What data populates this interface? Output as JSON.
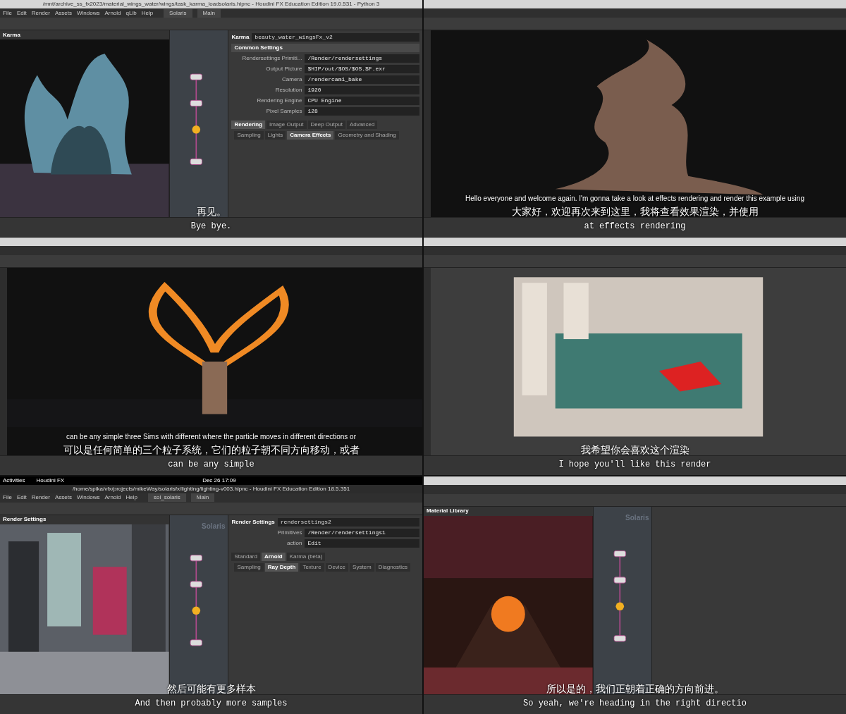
{
  "panels": [
    {
      "kind": "water",
      "window_title": "/mnt/archive_ss_fx2023/material_wings_water/wings/task_karma_loadsolaris.hipnc - Houdini FX Education Edition 19.0.531 - Python 3",
      "menu": [
        "File",
        "Edit",
        "Render",
        "Assets",
        "Windows",
        "Arnold",
        "qLib",
        "Help"
      ],
      "desktops": [
        "Solaris",
        "Main"
      ],
      "viewport_title": "Karma",
      "params": {
        "type": "Karma",
        "node": "beauty_water_wingsFx_v2",
        "section": "Common Settings",
        "rows": [
          {
            "label": "Rendersettings Primiti...",
            "value": "/Render/rendersettings"
          },
          {
            "label": "Output Picture",
            "value": "$HIP/out/$OS/$OS.$F.exr"
          },
          {
            "label": "Camera",
            "value": "/rendercam1_bake"
          },
          {
            "label": "Resolution",
            "value": "1920"
          },
          {
            "label": "Rendering Engine",
            "value": "CPU Engine"
          },
          {
            "label": "Pixel Samples",
            "value": "128"
          }
        ],
        "tabs": [
          {
            "label": "Rendering",
            "selected": true
          },
          {
            "label": "Image Output",
            "selected": false
          },
          {
            "label": "Deep Output",
            "selected": false
          },
          {
            "label": "Advanced",
            "selected": false
          }
        ],
        "subtabs": [
          {
            "label": "Sampling",
            "selected": false
          },
          {
            "label": "Lights",
            "selected": false
          },
          {
            "label": "Camera Effects",
            "selected": true
          },
          {
            "label": "Geometry and Shading",
            "selected": false
          }
        ]
      },
      "subtitles": [
        {
          "kind": "cjk",
          "text": "再见。"
        },
        {
          "kind": "mono",
          "text": "Bye bye."
        }
      ]
    },
    {
      "kind": "smoke",
      "subtitles": [
        {
          "kind": "en",
          "text": "Hello everyone and welcome again. I'm gonna take a look at effects rendering and render this example using"
        },
        {
          "kind": "cjk",
          "text": "大家好，欢迎再次来到这里，我将查看效果渲染，并使用"
        },
        {
          "kind": "mono",
          "text": "at effects rendering"
        }
      ]
    },
    {
      "kind": "fire",
      "subtitles": [
        {
          "kind": "en",
          "text": "can be any simple three Sims with different where the particle moves in different directions or"
        },
        {
          "kind": "cjk",
          "text": "可以是任何简单的三个粒子系统，它们的粒子朝不同方向移动，或者"
        },
        {
          "kind": "mono",
          "text": "can be any simple"
        }
      ]
    },
    {
      "kind": "pipes",
      "subtitles": [
        {
          "kind": "cjk",
          "text": "我希望你会喜欢这个渲染"
        },
        {
          "kind": "mono",
          "text": "I hope you'll like this render"
        }
      ]
    },
    {
      "kind": "city",
      "system_bar": {
        "left": [
          "Activities",
          "Houdini FX"
        ],
        "clock": "Dec 26 17:09"
      },
      "window_title": "/home/spika/vfx/projects/mikeWay/solarisfx/lighting/lighting-v003.hipnc - Houdini FX Education Edition 18.5.351",
      "menu": [
        "File",
        "Edit",
        "Render",
        "Assets",
        "Windows",
        "Arnold",
        "Help"
      ],
      "desktops": [
        "sol_solaris",
        "Main"
      ],
      "viewport_title": "Render Settings",
      "network_label": "Solaris",
      "params": {
        "type": "Render Settings",
        "node": "rendersettings2",
        "rows": [
          {
            "label": "Primitives",
            "value": "/Render/rendersettings1"
          },
          {
            "label": "action",
            "value": "Edit"
          }
        ],
        "tabs": [
          {
            "label": "Standard",
            "selected": false
          },
          {
            "label": "Arnold",
            "selected": true
          },
          {
            "label": "Karma (beta)",
            "selected": false
          }
        ],
        "subtabs": [
          {
            "label": "Sampling",
            "selected": false
          },
          {
            "label": "Ray Depth",
            "selected": true
          },
          {
            "label": "Texture",
            "selected": false
          },
          {
            "label": "Device",
            "selected": false
          },
          {
            "label": "System",
            "selected": false
          },
          {
            "label": "Diagnostics",
            "selected": false
          }
        ]
      },
      "subtitles": [
        {
          "kind": "cjk",
          "text": "然后可能有更多样本"
        },
        {
          "kind": "mono",
          "text": "And then probably more samples"
        }
      ]
    },
    {
      "kind": "tunnel",
      "viewport_title": "Material Library",
      "network_label": "Solaris",
      "subtitles": [
        {
          "kind": "cjk",
          "text": "所以是的，我们正朝着正确的方向前进。"
        },
        {
          "kind": "mono",
          "text": "So yeah, we're heading in the right directio"
        }
      ]
    }
  ]
}
